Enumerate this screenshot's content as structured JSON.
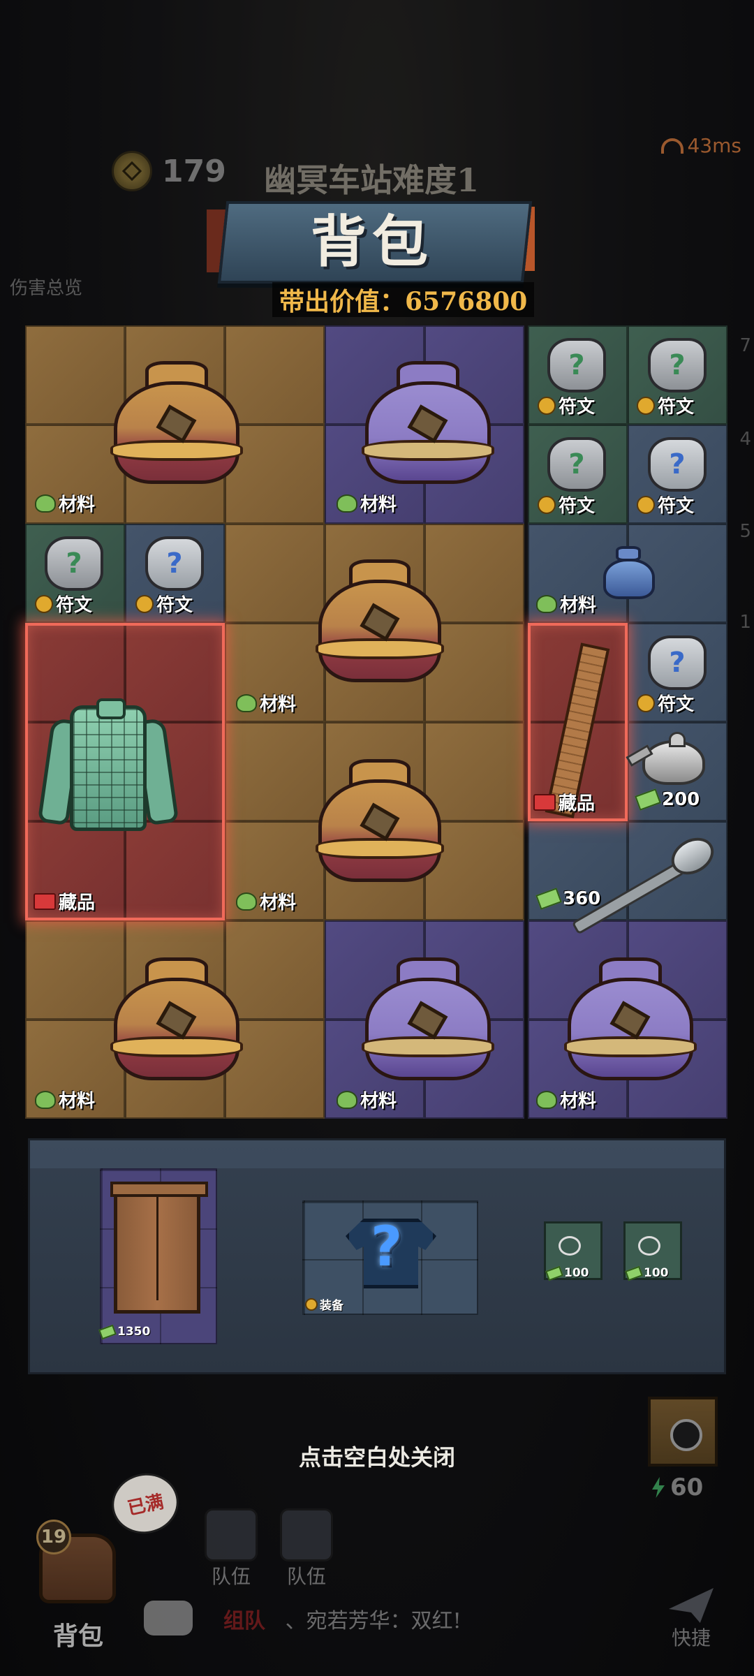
{
  "hud": {
    "coins": "179",
    "level_name": "幽冥车站难度1",
    "ping": "43ms",
    "damage_overview": "伤害总览"
  },
  "panel_title": "背包",
  "carry_value": "带出价值：6576800",
  "grid_items": {
    "bag1_tag": "材料",
    "bag2_tag": "材料",
    "rune1_tag": "符文",
    "rune2_tag": "符文",
    "rune3_tag": "符文",
    "rune4_tag": "符文",
    "rune5_tag": "符文",
    "rune6_tag": "符文",
    "minibag_tag": "材料",
    "bag3_tag": "材料",
    "rune7_tag": "符文",
    "armor_tag": "藏品",
    "ruler_tag": "藏品",
    "teapot_value": "200",
    "bag4_tag": "材料",
    "spoon_value": "360",
    "bag5_tag": "材料",
    "bag6_tag": "材料",
    "bag7_tag": "材料"
  },
  "ground_items": {
    "wardrobe_value": "1350",
    "equip_tag": "装备",
    "glasses1_value": "100",
    "glasses2_value": "100"
  },
  "close_hint": "点击空白处关闭",
  "bottom": {
    "bag_count": "19",
    "bag_label": "背包",
    "bubble": "已满",
    "team_voice_label": "队伍",
    "team_sound_label": "队伍",
    "chat_channel": "组队",
    "chat_message": "、宛若芳华：双红!",
    "quick_label": "快捷",
    "energy": "60"
  },
  "colors": {
    "accent_gold": "#f0b84a",
    "highlight_red": "#f06a5a"
  }
}
